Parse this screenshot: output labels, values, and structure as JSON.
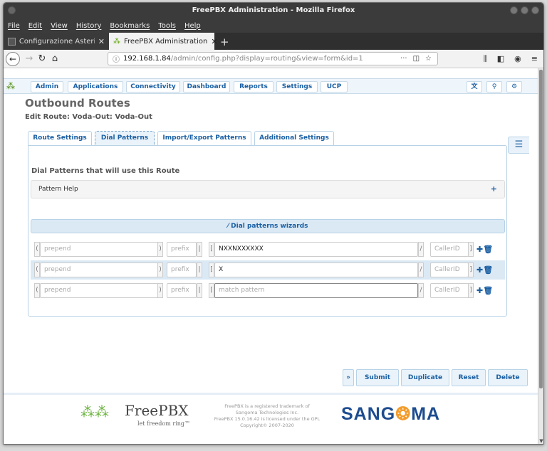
{
  "window": {
    "title": "FreePBX Administration - Mozilla Firefox"
  },
  "menu": [
    "File",
    "Edit",
    "View",
    "History",
    "Bookmarks",
    "Tools",
    "Help"
  ],
  "tabs": [
    {
      "label": "Configurazione Asterisk"
    },
    {
      "label": "FreePBX Administration"
    }
  ],
  "url": {
    "host": "192.168.1.84",
    "path": "/admin/config.php?display=routing&view=form&id=1"
  },
  "topnav": [
    "Admin",
    "Applications",
    "Connectivity",
    "Dashboard",
    "Reports",
    "Settings",
    "UCP"
  ],
  "page": {
    "title": "Outbound Routes",
    "subtitle": "Edit Route: Voda-Out: Voda-Out"
  },
  "form_tabs": [
    "Route Settings",
    "Dial Patterns",
    "Import/Export Patterns",
    "Additional Settings"
  ],
  "dial_patterns": {
    "heading": "Dial Patterns that will use this Route",
    "help_label": "Pattern Help",
    "wizard_label": "Dial patterns wizards",
    "placeholders": {
      "prepend": "prepend",
      "prefix": "prefix",
      "match": "match pattern",
      "callerid": "CallerID"
    },
    "rows": [
      {
        "match": "NXXNXXXXXX"
      },
      {
        "match": "X"
      },
      {
        "match": ""
      }
    ]
  },
  "actions": {
    "submit": "Submit",
    "duplicate": "Duplicate",
    "reset": "Reset",
    "delete": "Delete"
  },
  "footer": {
    "brand": "FreePBX",
    "slogan": "let freedom ring™",
    "legal": [
      "FreePBX is a registered trademark of",
      "Sangoma Technologies Inc.",
      "FreePBX 15.0.16.42 is licensed under the GPL",
      "Copyright© 2007-2020"
    ],
    "sangoma_left": "SANG",
    "sangoma_right": "MA"
  },
  "colors": {
    "accent": "#1a5fa3",
    "panel": "#dbe9f5",
    "chrome": "#3b3b3b"
  }
}
